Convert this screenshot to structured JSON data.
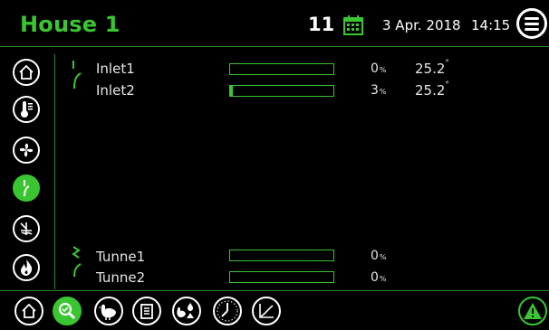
{
  "header": {
    "title": "House 1",
    "day": "11",
    "date": "3 Apr. 2018",
    "time": "14:15"
  },
  "icons": {
    "calendar": "calendar-icon",
    "menu": "menu-icon",
    "alarm": "alarm-icon"
  },
  "sidebar": {
    "items": [
      "home",
      "temperature",
      "ventilation",
      "inlets",
      "controlled-valve",
      "heating"
    ],
    "active": "inlets"
  },
  "inlets": [
    {
      "label": "Inlet1",
      "percent": "0",
      "unit": "%",
      "temp": "25.2",
      "deg": "°",
      "level": 0.0
    },
    {
      "label": "Inlet2",
      "percent": "3",
      "unit": "%",
      "temp": "25.2",
      "deg": "°",
      "level": 0.03
    }
  ],
  "tunnels": [
    {
      "label": "Tunne1",
      "percent": "0",
      "unit": "%",
      "level": 0.0
    },
    {
      "label": "Tunne2",
      "percent": "0",
      "unit": "%",
      "level": 0.0
    }
  ],
  "bottom_bar": {
    "items": [
      "home",
      "search-view",
      "animals",
      "notes",
      "feed-water",
      "clock",
      "graph"
    ],
    "active": "search-view"
  },
  "colors": {
    "accent": "#39c630",
    "background": "#000000",
    "text": "#e6e6e6"
  }
}
